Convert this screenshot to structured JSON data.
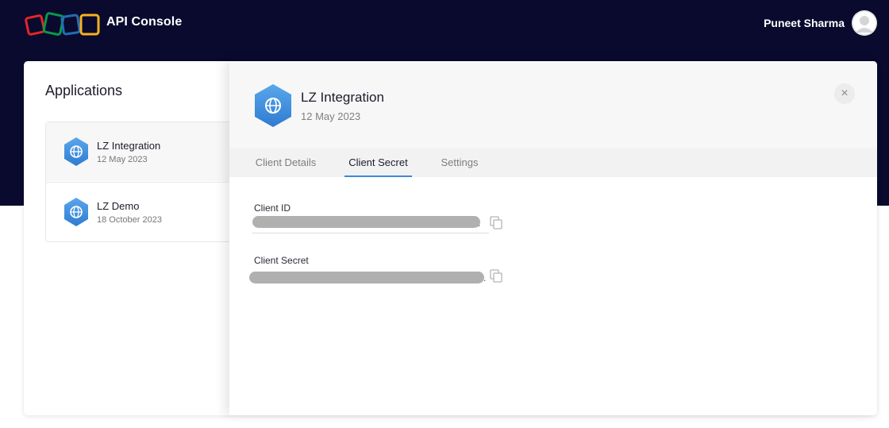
{
  "header": {
    "app_title": "API Console",
    "user_name": "Puneet Sharma"
  },
  "applications": {
    "heading": "Applications",
    "items": [
      {
        "name": "LZ Integration",
        "date": "12 May 2023"
      },
      {
        "name": "LZ Demo",
        "date": "18 October 2023"
      }
    ]
  },
  "panel": {
    "title": "LZ Integration",
    "date": "12 May 2023",
    "close_symbol": "×",
    "tabs": [
      {
        "label": "Client Details"
      },
      {
        "label": "Client Secret"
      },
      {
        "label": "Settings"
      }
    ],
    "active_tab": "Client Secret",
    "fields": [
      {
        "label": "Client ID",
        "value_masked": true
      },
      {
        "label": "Client Secret",
        "value_masked": true
      }
    ]
  },
  "colors": {
    "header_bg": "#090a2e",
    "accent": "#3d87d9",
    "logo_red": "#e42527",
    "logo_green": "#089949",
    "logo_blue": "#226db4",
    "logo_yellow": "#f9b21d"
  },
  "icons": [
    "zoho-logo",
    "user-avatar-icon",
    "globe-icon",
    "close-icon",
    "copy-icon"
  ]
}
